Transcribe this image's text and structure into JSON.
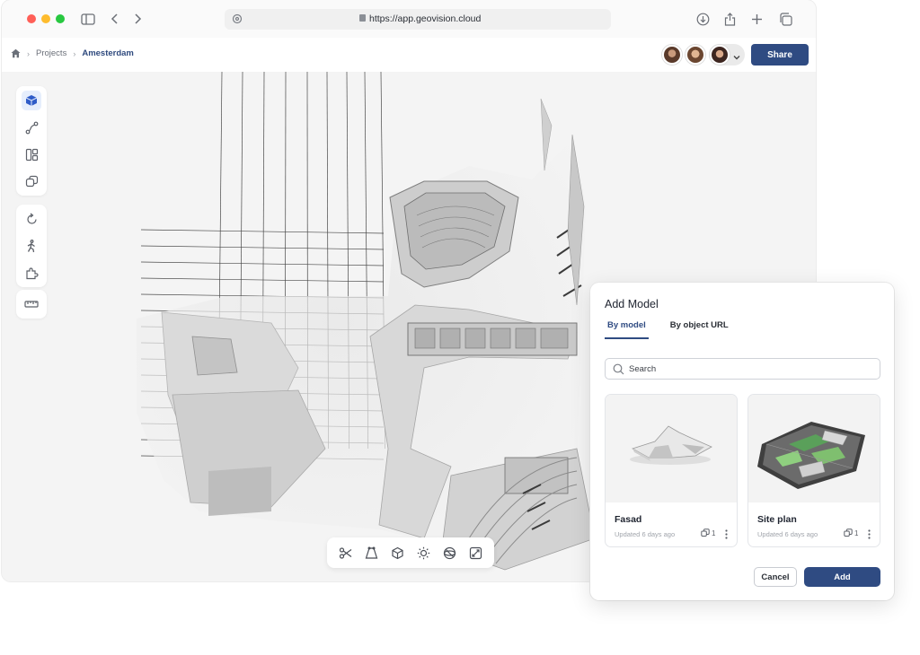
{
  "browser": {
    "url": "https://app.geovision.cloud"
  },
  "breadcrumb": {
    "items": [
      "Projects",
      "Amesterdam"
    ]
  },
  "header": {
    "share_label": "Share"
  },
  "icons": {
    "chrome": [
      "sidebar-icon",
      "back-icon",
      "forward-icon",
      "reload-icon",
      "lock-icon",
      "download-icon",
      "share-icon",
      "new-tab-icon",
      "tabs-icon"
    ],
    "rail_group_1": [
      "cube-icon",
      "path-icon",
      "layout-icon",
      "layers-icon"
    ],
    "rail_group_2": [
      "rotate-icon",
      "walk-icon",
      "puzzle-icon"
    ],
    "rail_group_3": [
      "ruler-icon"
    ],
    "bottom_toolbar": [
      "scissors-icon",
      "perspective-icon",
      "box-icon",
      "sun-icon",
      "sphere-icon",
      "expand-icon"
    ]
  },
  "colors": {
    "accent": "#2f4b82",
    "active_tool": "#2f5cc8"
  },
  "add_model": {
    "title": "Add Model",
    "tabs": [
      {
        "label": "By model",
        "active": true
      },
      {
        "label": "By object URL",
        "active": false
      }
    ],
    "search_placeholder": "Search",
    "models": [
      {
        "name": "Fasad",
        "updated": "Updated 6 days ago",
        "count": "1"
      },
      {
        "name": "Site plan",
        "updated": "Updated 6 days ago",
        "count": "1"
      }
    ],
    "cancel_label": "Cancel",
    "add_label": "Add"
  }
}
